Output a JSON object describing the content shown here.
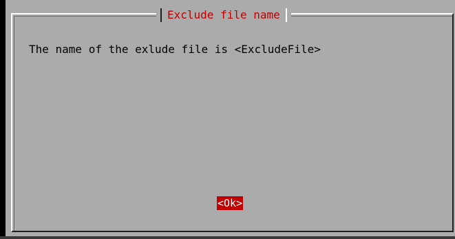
{
  "dialog": {
    "title": "Exclude file name",
    "message": "The name of the exlude file is <ExcludeFile>",
    "ok_label": "<Ok>"
  },
  "colors": {
    "background": "#ababab",
    "title_text": "#c00000",
    "button_bg": "#c00000",
    "button_text": "#ffffff"
  }
}
